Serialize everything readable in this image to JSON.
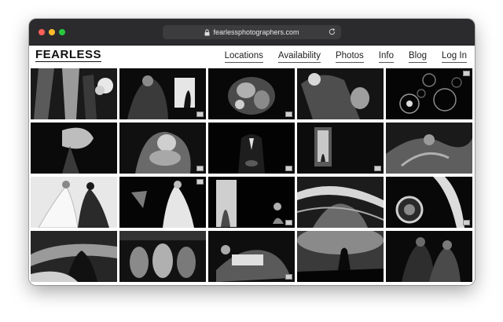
{
  "browser": {
    "url": "fearlessphotographers.com"
  },
  "site": {
    "logo": "FEARLESS",
    "nav": [
      "Locations",
      "Availability",
      "Photos",
      "Info",
      "Blog",
      "Log In"
    ]
  },
  "colors": {
    "titlebar": "#2b2b2d",
    "urlbar": "#3c3c3e",
    "traffic_red": "#fe5f57",
    "traffic_yellow": "#febc2e",
    "traffic_green": "#28c840"
  }
}
